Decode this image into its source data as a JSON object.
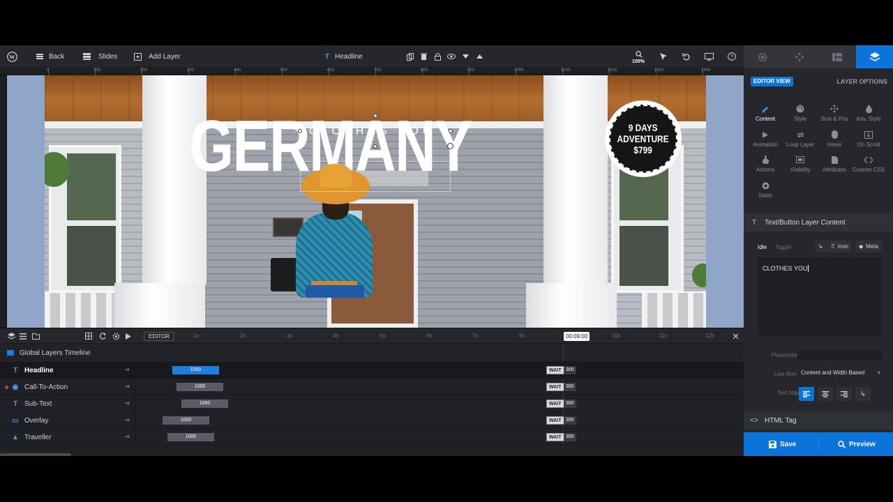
{
  "toolbar": {
    "back": "Back",
    "slides": "Slides",
    "add_layer": "Add Layer",
    "current_layer": "Headline",
    "zoom": "100%"
  },
  "ruler": {
    "ticks": [
      "0",
      "100",
      "200",
      "300",
      "400",
      "500",
      "600",
      "700",
      "800",
      "900",
      "1000",
      "1100",
      "1200",
      "1300",
      "1400"
    ]
  },
  "canvas": {
    "headline": "CLOTHES YOU",
    "title": "GERMANY",
    "badge_line1": "9 DAYS",
    "badge_line2": "ADVENTURE",
    "badge_line3": "$799"
  },
  "right_panel": {
    "editor_view": "EDITOR VIEW",
    "layer_options": "LAYER OPTIONS",
    "options": [
      {
        "label": "Content",
        "icon": "pencil-icon"
      },
      {
        "label": "Style",
        "icon": "palette-icon"
      },
      {
        "label": "Size & Pos",
        "icon": "move-icon"
      },
      {
        "label": "Adv. Style",
        "icon": "contrast-icon"
      },
      {
        "label": "Animation",
        "icon": "play-icon"
      },
      {
        "label": "Loop Layer",
        "icon": "loop-icon"
      },
      {
        "label": "Hover",
        "icon": "mouse-icon"
      },
      {
        "label": "On Scroll",
        "icon": "scroll-icon"
      },
      {
        "label": "Actions",
        "icon": "hand-icon"
      },
      {
        "label": "Visibility",
        "icon": "visibility-icon"
      },
      {
        "label": "Attributes",
        "icon": "file-icon"
      },
      {
        "label": "Custom CSS",
        "icon": "code-icon"
      },
      {
        "label": "Static",
        "icon": "static-icon"
      }
    ],
    "section_title": "Text/Button Layer Content",
    "idle": "Idle",
    "toggle": "Toggle",
    "icon_btn": "Icon",
    "meta_btn": "Meta",
    "content_text": "CLOTHES YOU",
    "placeholder_label": "Placeholder",
    "placeholder_value": "",
    "line_break_label": "Line Break",
    "line_break_value": "Content and Width Based",
    "text_align_label": "Text Align",
    "html_tag": "HTML Tag",
    "save": "Save",
    "preview": "Preview"
  },
  "timeline": {
    "editor_label": "EDITOR",
    "time": "00:09:00",
    "seconds": [
      "1s",
      "2s",
      "3s",
      "4s",
      "5s",
      "6s",
      "7s",
      "8s",
      "10s",
      "11s",
      "12s"
    ],
    "global_label": "Global Layers Timeline",
    "rows": [
      {
        "name": "Headline",
        "duration": "1000",
        "wait": "WAIT",
        "wait_value": "300"
      },
      {
        "name": "Call-To-Action",
        "duration": "1000",
        "wait": "WAIT",
        "wait_value": "300"
      },
      {
        "name": "Sub-Text",
        "duration": "1000",
        "wait": "WAIT",
        "wait_value": "300"
      },
      {
        "name": "Overlay",
        "duration": "1000",
        "wait": "WAIT",
        "wait_value": "300"
      },
      {
        "name": "Traveller",
        "duration": "1000",
        "wait": "WAIT",
        "wait_value": "300"
      }
    ]
  },
  "colors": {
    "accent": "#0a74da",
    "panel": "#26272c",
    "timeline": "#202126"
  }
}
